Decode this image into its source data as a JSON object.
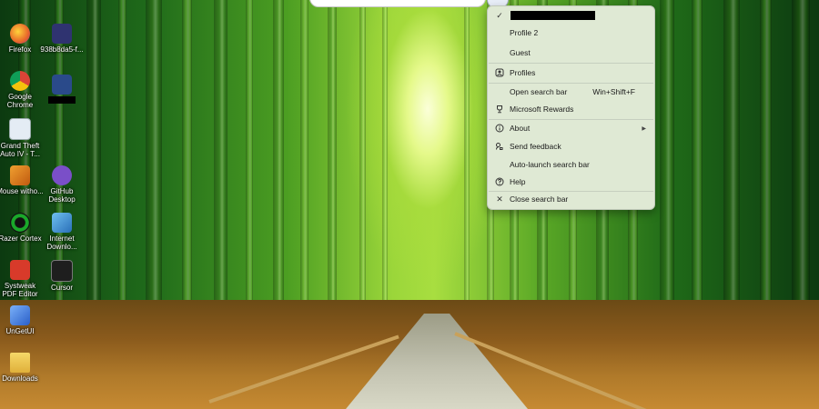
{
  "desktop": {
    "icons": [
      {
        "label": "Firefox",
        "icon": "firefox-icon",
        "color": "#e8662a"
      },
      {
        "label": "938b8da5-f...",
        "icon": "image-file-icon",
        "color": "#3a3f8c"
      },
      {
        "label": "Google Chrome",
        "icon": "chrome-icon",
        "color": "#2f9e4a"
      },
      {
        "label": "",
        "icon": "image-file-icon",
        "color": "#2a4a8a"
      },
      {
        "label": "Grand Theft Auto IV - T...",
        "icon": "gta-shortcut-icon",
        "color": "#d8e4f0"
      },
      {
        "label": "Mouse witho...",
        "icon": "mouse-app-icon",
        "color": "#e07a20"
      },
      {
        "label": "GitHub Desktop",
        "icon": "github-desktop-icon",
        "color": "#7a4fc8"
      },
      {
        "label": "Razer Cortex",
        "icon": "razer-cortex-icon",
        "color": "#1aa82a"
      },
      {
        "label": "Internet Downlo...",
        "icon": "idm-icon",
        "color": "#3a8fd8"
      },
      {
        "label": "Systweak PDF Editor",
        "icon": "pdf-editor-icon",
        "color": "#d83a2a"
      },
      {
        "label": "Cursor",
        "icon": "cursor-app-icon",
        "color": "#222222"
      },
      {
        "label": "UnGetUI",
        "icon": "unigetui-icon",
        "color": "#3a6fd8"
      },
      {
        "label": "Downloads",
        "icon": "folder-icon",
        "color": "#e8c04a"
      }
    ]
  },
  "menu": {
    "items": [
      {
        "label": "",
        "icon": "check-icon",
        "redacted": true
      },
      {
        "label": "Profile 2",
        "icon": ""
      },
      {
        "label": "Guest",
        "icon": ""
      },
      {
        "label": "Profiles",
        "icon": "profiles-icon"
      },
      {
        "label": "Open search bar",
        "icon": "",
        "shortcut": "Win+Shift+F"
      },
      {
        "label": "Microsoft Rewards",
        "icon": "trophy-icon"
      },
      {
        "label": "About",
        "icon": "info-icon",
        "submenu": true
      },
      {
        "label": "Send feedback",
        "icon": "feedback-icon"
      },
      {
        "label": "Auto-launch search bar",
        "icon": ""
      },
      {
        "label": "Help",
        "icon": "help-icon"
      },
      {
        "label": "Close search bar",
        "icon": "close-icon"
      }
    ]
  },
  "colors": {
    "menu_background": "#dfe9d4",
    "menu_text": "#1b1b1b"
  }
}
